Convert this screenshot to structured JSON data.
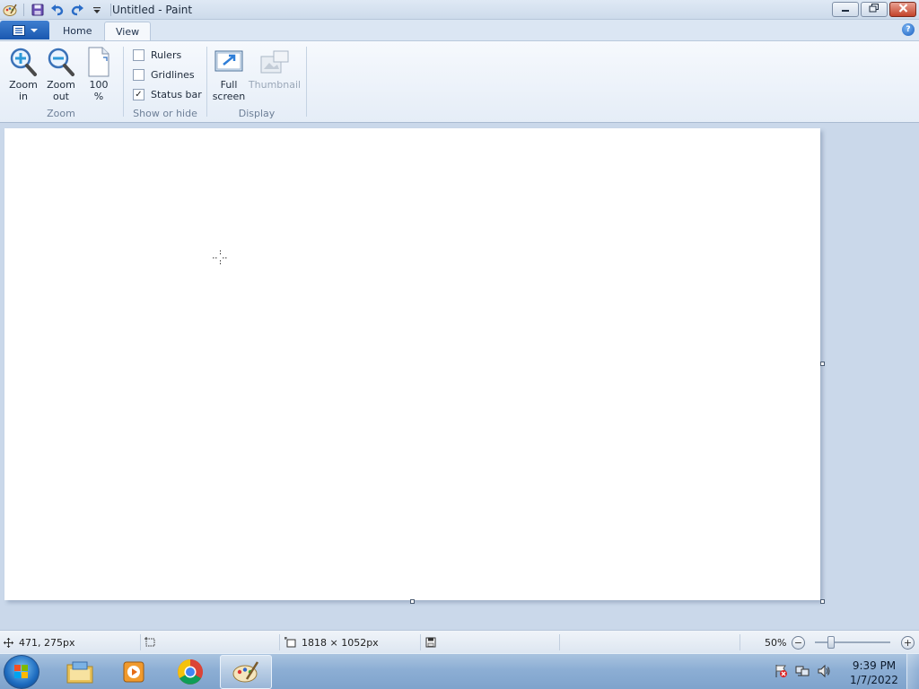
{
  "window": {
    "title": "Untitled - Paint",
    "controls": {
      "minimize": "minimize-icon",
      "restore": "restore-icon",
      "close": "close-icon"
    }
  },
  "quick_access": [
    "paint-app-icon",
    "save-icon",
    "undo-icon",
    "redo-icon",
    "customize-dropdown-icon"
  ],
  "tabs": [
    {
      "label": "Home",
      "active": false
    },
    {
      "label": "View",
      "active": true
    }
  ],
  "ribbon": {
    "zoom": {
      "label": "Zoom",
      "zoom_in": {
        "line1": "Zoom",
        "line2": "in"
      },
      "zoom_out": {
        "line1": "Zoom",
        "line2": "out"
      },
      "hundred": {
        "line1": "100",
        "line2": "%"
      }
    },
    "show_hide": {
      "label": "Show or hide",
      "items": [
        {
          "label": "Rulers",
          "checked": false
        },
        {
          "label": "Gridlines",
          "checked": false
        },
        {
          "label": "Status bar",
          "checked": true
        }
      ]
    },
    "display": {
      "label": "Display",
      "full_screen": {
        "line1": "Full",
        "line2": "screen"
      },
      "thumbnail": {
        "label": "Thumbnail",
        "enabled": false
      }
    }
  },
  "statusbar": {
    "cursor_position": "471, 275px",
    "canvas_size": "1818 × 1052px",
    "zoom_level": "50%",
    "zoom_fraction": 0.5
  },
  "taskbar": {
    "apps": [
      "windows-explorer-icon",
      "media-player-icon",
      "chrome-icon",
      "paint-icon"
    ],
    "tray_icons": [
      "action-center-flag-icon",
      "network-icon",
      "volume-icon"
    ],
    "time": "9:39 PM",
    "date": "1/7/2022"
  },
  "colors": {
    "file_tab": "#1a58b0",
    "workspace": "#cad8ea",
    "close_button": "#c3432a"
  }
}
